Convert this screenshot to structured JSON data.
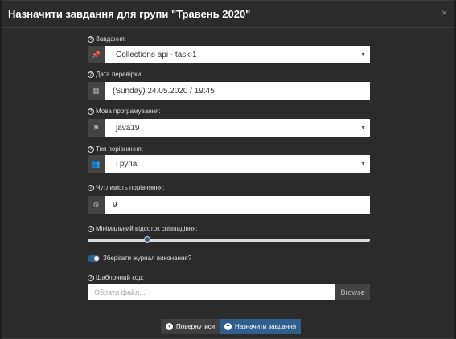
{
  "header": {
    "title": "Назначити завдання для групи \"Травень 2020\"",
    "close": "×"
  },
  "fields": {
    "task": {
      "label": "Завдання:",
      "value": "Collections api - task 1",
      "icon": "pin-icon"
    },
    "date": {
      "label": "Дата перевірки:",
      "value": "(Sunday) 24.05.2020 / 19:45",
      "icon": "calendar-icon"
    },
    "language": {
      "label": "Мова програмування:",
      "value": "java19",
      "icon": "language-icon"
    },
    "compare_type": {
      "label": "Тип порівняння:",
      "value": "Група",
      "icon": "users-icon"
    },
    "sensitivity": {
      "label": "Чутливість порівняння:",
      "value": "9",
      "icon": "cogs-icon"
    },
    "min_percent": {
      "label": "Мінімальний відсоток співпадіння:",
      "value_fraction": 0.2
    },
    "save_log": {
      "label": "Зберігати журнал виконання?",
      "checked": true
    },
    "template": {
      "label": "Шаблонний код:",
      "placeholder": "Обрати файл...",
      "browse": "Browse"
    }
  },
  "footer": {
    "back": "Повернутися",
    "assign": "Назначити завдання"
  }
}
